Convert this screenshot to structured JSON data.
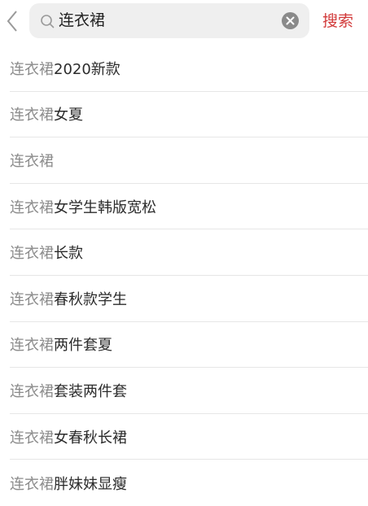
{
  "header": {
    "back_icon": "chevron-left-icon",
    "search_icon": "search-icon",
    "clear_icon": "clear-icon",
    "search_value": "连衣裙",
    "search_button_label": "搜索",
    "accent_color": "#d23a3a"
  },
  "suggestions": [
    {
      "prefix": "连衣裙",
      "suffix": "2020新款"
    },
    {
      "prefix": "连衣裙",
      "suffix": "女夏"
    },
    {
      "prefix": "连衣裙",
      "suffix": ""
    },
    {
      "prefix": "连衣裙",
      "suffix": "女学生韩版宽松"
    },
    {
      "prefix": "连衣裙",
      "suffix": "长款"
    },
    {
      "prefix": "连衣裙",
      "suffix": "春秋款学生"
    },
    {
      "prefix": "连衣裙",
      "suffix": "两件套夏"
    },
    {
      "prefix": "连衣裙",
      "suffix": "套装两件套"
    },
    {
      "prefix": "连衣裙",
      "suffix": "女春秋长裙"
    },
    {
      "prefix": "连衣裙",
      "suffix": "胖妹妹显瘦"
    }
  ]
}
